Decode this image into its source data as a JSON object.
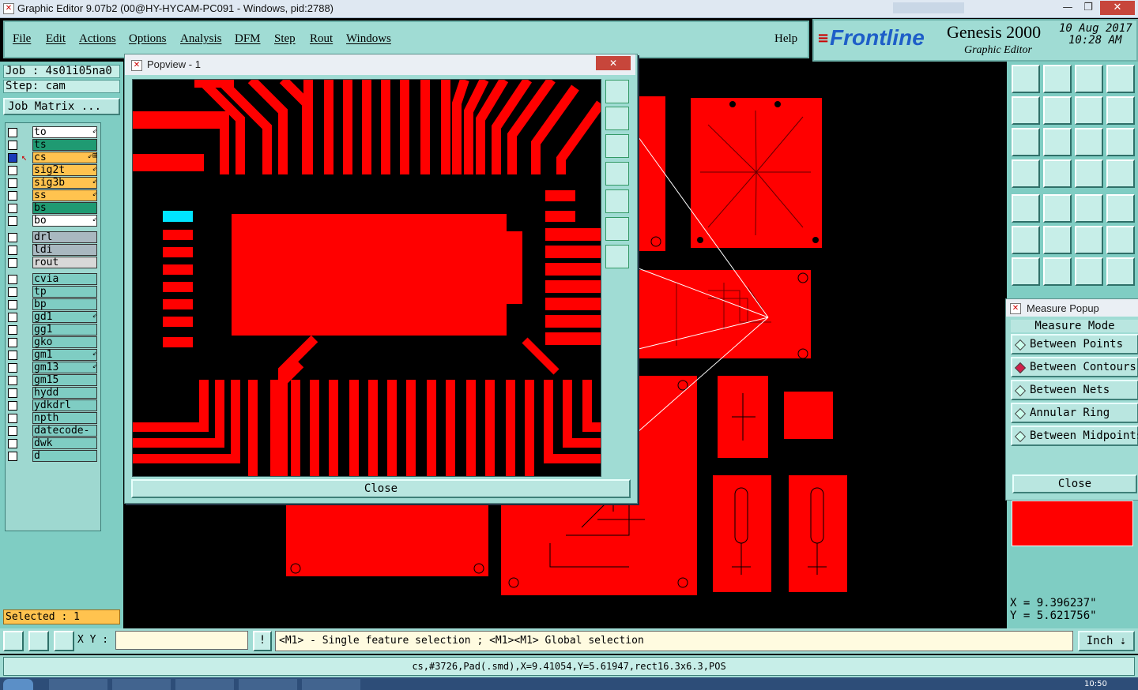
{
  "window": {
    "title": "Graphic Editor 9.07b2 (00@HY-HYCAM-PC091 - Windows, pid:2788)",
    "minimize": "—",
    "restore": "❐",
    "close": "✕"
  },
  "menu": {
    "items": [
      "File",
      "Edit",
      "Actions",
      "Options",
      "Analysis",
      "DFM",
      "Step",
      "Rout",
      "Windows"
    ],
    "help": "Help"
  },
  "brand": {
    "logo": "Frontline",
    "product": "Genesis 2000",
    "subtitle": "Graphic Editor",
    "date": "10 Aug 2017",
    "time": "10:28 AM"
  },
  "job": {
    "job_label": "Job : 4s01i05na0",
    "step_label": "Step: cam",
    "matrix_button": "Job Matrix ..."
  },
  "layers": [
    {
      "name": "to",
      "color": "#ffffff",
      "mark": "⇙"
    },
    {
      "name": "ts",
      "color": "#1f9a72",
      "mark": ""
    },
    {
      "name": "cs",
      "color": "#ffc34f",
      "mark": "⇙⊞",
      "active": true
    },
    {
      "name": "sig2t",
      "color": "#ffc34f",
      "mark": "⇙"
    },
    {
      "name": "sig3b",
      "color": "#ffc34f",
      "mark": "⇙"
    },
    {
      "name": "ss",
      "color": "#ffc34f",
      "mark": "⇙"
    },
    {
      "name": "bs",
      "color": "#1f9a72",
      "mark": ""
    },
    {
      "name": "bo",
      "color": "#ffffff",
      "mark": "⇙"
    },
    {
      "name": "drl",
      "color": "#a9b8c0",
      "mark": ""
    },
    {
      "name": "ldi",
      "color": "#a9b8c0",
      "mark": ""
    },
    {
      "name": "rout",
      "color": "#d8d8d8",
      "mark": ""
    },
    {
      "name": "cvia",
      "color": "#7fcdc3",
      "mark": ""
    },
    {
      "name": "tp",
      "color": "#7fcdc3",
      "mark": ""
    },
    {
      "name": "bp",
      "color": "#7fcdc3",
      "mark": ""
    },
    {
      "name": "gd1",
      "color": "#7fcdc3",
      "mark": "⇙"
    },
    {
      "name": "gg1",
      "color": "#7fcdc3",
      "mark": ""
    },
    {
      "name": "gko",
      "color": "#7fcdc3",
      "mark": ""
    },
    {
      "name": "gm1",
      "color": "#7fcdc3",
      "mark": "⇙"
    },
    {
      "name": "gm13",
      "color": "#7fcdc3",
      "mark": "⇙"
    },
    {
      "name": "gm15",
      "color": "#7fcdc3",
      "mark": ""
    },
    {
      "name": "hydd",
      "color": "#7fcdc3",
      "mark": ""
    },
    {
      "name": "ydkdrl",
      "color": "#7fcdc3",
      "mark": ""
    },
    {
      "name": "npth",
      "color": "#7fcdc3",
      "mark": ""
    },
    {
      "name": "datecode-to",
      "color": "#7fcdc3",
      "mark": ""
    },
    {
      "name": "dwk",
      "color": "#7fcdc3",
      "mark": ""
    },
    {
      "name": "d",
      "color": "#7fcdc3",
      "mark": ""
    }
  ],
  "selected": "Selected : 1",
  "popview": {
    "title": "Popview - 1",
    "close_x": "✕",
    "close_button": "Close"
  },
  "measure": {
    "title": "Measure Popup",
    "mode_header": "Measure Mode",
    "options": [
      {
        "label": "Between Points",
        "selected": false
      },
      {
        "label": "Between Contours",
        "selected": true
      },
      {
        "label": "Between Nets",
        "selected": false
      },
      {
        "label": "Annular Ring",
        "selected": false
      },
      {
        "label": "Between Midpoints",
        "selected": false
      }
    ],
    "close_button": "Close"
  },
  "coords": {
    "x": "X = 9.396237\"",
    "y": "Y = 5.621756\""
  },
  "command": {
    "xy_label": "X Y :",
    "xy_value": "",
    "hint": "<M1> - Single feature selection ; <M1><M1> Global selection",
    "units": "Inch"
  },
  "status": "cs,#3726,Pad(.smd),X=9.41054,Y=5.61947,rect16.3x6.3,POS",
  "clock": "10:50",
  "colors": {
    "panel": "#a0dcd4",
    "panel_dark": "#7fcdc3",
    "copper": "#ff0000",
    "highlight": "#00e5ff"
  }
}
